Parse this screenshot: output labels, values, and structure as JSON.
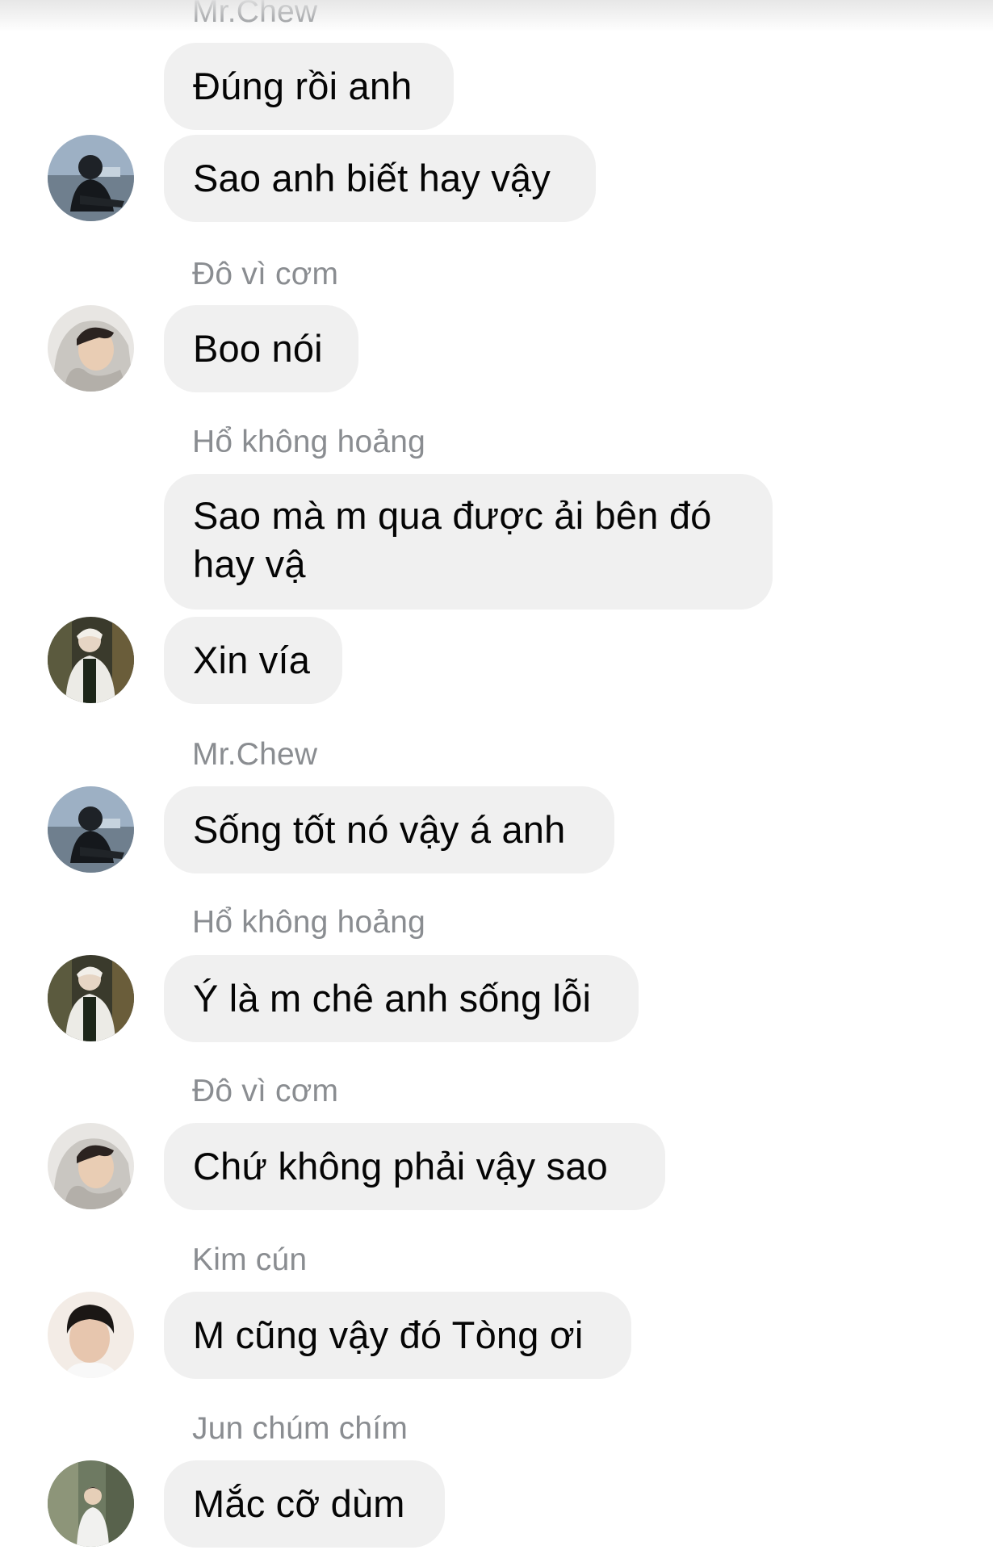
{
  "messages": [
    {
      "sender": "Mr.Chew",
      "text": "Đúng rồi anh"
    },
    {
      "text": "Sao anh biết hay vậy",
      "avatar": "avatar-mrchew-icon"
    },
    {
      "sender": "Đô vì cơm",
      "text": "Boo nói",
      "avatar": "avatar-do-vi-com-icon"
    },
    {
      "sender": "Hổ không hoảng",
      "text": "Sao mà m qua được ải bên đó hay vậ"
    },
    {
      "text": "Xin vía",
      "avatar": "avatar-ho-khong-hoang-icon"
    },
    {
      "sender": "Mr.Chew",
      "text": "Sống tốt nó vậy á anh",
      "avatar": "avatar-mrchew-icon"
    },
    {
      "sender": "Hổ không hoảng",
      "text": "Ý là m chê anh sống lỗi",
      "avatar": "avatar-ho-khong-hoang-icon"
    },
    {
      "sender": "Đô vì cơm",
      "text": "Chứ không phải vậy sao",
      "avatar": "avatar-do-vi-com-icon"
    },
    {
      "sender": "Kim cún",
      "text": "M cũng vậy đó Tòng ơi",
      "avatar": "avatar-kim-cun-icon"
    },
    {
      "sender": "Jun chúm chím",
      "text": "Mắc cỡ dùm",
      "avatar": "avatar-jun-chum-chim-icon"
    }
  ],
  "colors": {
    "bubble_background": "#f0f0f0",
    "message_text": "#050505",
    "sender_text": "#8a8d91",
    "page_background": "#ffffff"
  }
}
